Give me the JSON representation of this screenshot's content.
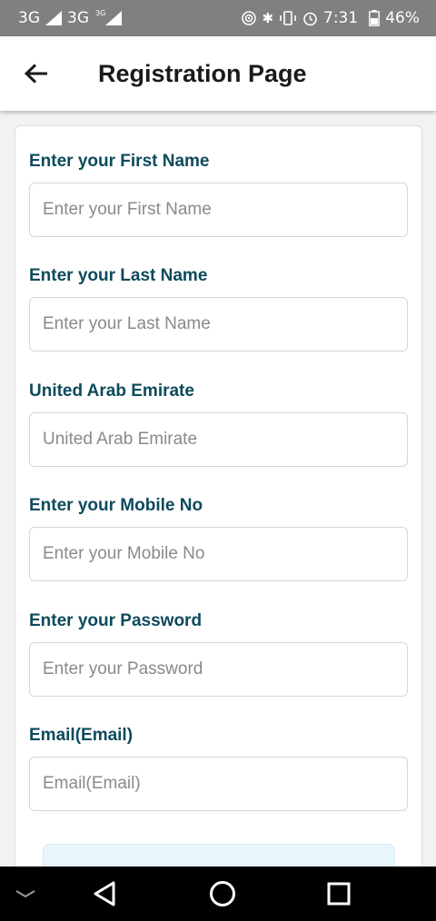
{
  "status_bar": {
    "network1": "3G",
    "network2": "3G",
    "network2_sup": "3G",
    "time": "7:31",
    "battery": "46%"
  },
  "app_bar": {
    "title": "Registration Page"
  },
  "form": {
    "fields": [
      {
        "label": "Enter your First Name",
        "placeholder": "Enter your First Name"
      },
      {
        "label": "Enter your Last Name",
        "placeholder": "Enter your Last Name"
      },
      {
        "label": "United Arab Emirate",
        "placeholder": "United Arab Emirate"
      },
      {
        "label": "Enter your Mobile No",
        "placeholder": "Enter your Mobile No"
      },
      {
        "label": "Enter your Password",
        "placeholder": "Enter your Password"
      },
      {
        "label": "Email(Email)",
        "placeholder": "Email(Email)"
      }
    ]
  },
  "colors": {
    "label": "#0d4a5c",
    "status_bar": "#808080",
    "submit_bg": "#e8f6fc"
  }
}
